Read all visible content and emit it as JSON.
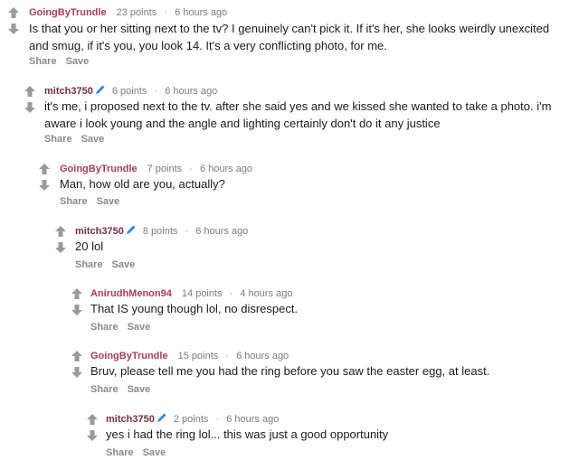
{
  "comments": [
    {
      "username": "GoingByTrundle",
      "points": "23 points",
      "time": "6 hours ago",
      "body": "Is that you or her sitting next to the tv? I genuinely can't pick it. If it's her, she looks weirdly unexcited and smug, if it's you, you look 14. It's a very conflicting photo, for me.",
      "share": "Share",
      "save": "Save"
    },
    {
      "username": "mitch3750",
      "points": "6 points",
      "time": "6 hours ago",
      "body": "it's me, i proposed next to the tv. after she said yes and we kissed she wanted to take a photo. i'm aware i look young and the angle and lighting certainly don't do it any justice",
      "share": "Share",
      "save": "Save"
    },
    {
      "username": "GoingByTrundle",
      "points": "7 points",
      "time": "6 hours ago",
      "body": "Man, how old are you, actually?",
      "share": "Share",
      "save": "Save"
    },
    {
      "username": "mitch3750",
      "points": "8 points",
      "time": "6 hours ago",
      "body": "20 lol",
      "share": "Share",
      "save": "Save"
    },
    {
      "username": "AnirudhMenon94",
      "points": "14 points",
      "time": "4 hours ago",
      "body": "That IS young though lol, no disrespect.",
      "share": "Share",
      "save": "Save"
    },
    {
      "username": "GoingByTrundle",
      "points": "15 points",
      "time": "6 hours ago",
      "body": "Bruv, please tell me you had the ring before you saw the easter egg, at least.",
      "share": "Share",
      "save": "Save"
    },
    {
      "username": "mitch3750",
      "points": "2 points",
      "time": "6 hours ago",
      "body": "yes i had the ring lol... this was just a good opportunity",
      "share": "Share",
      "save": "Save"
    }
  ],
  "icons": {
    "upvote": "upvote-arrow-icon",
    "downvote": "downvote-arrow-icon",
    "submitter": "pencil-icon"
  },
  "colors": {
    "arrow": "#9a9a9a",
    "submitter_icon": "#2d8ae8",
    "flair_user": "#a83d57",
    "author_user": "#7a2e42"
  }
}
